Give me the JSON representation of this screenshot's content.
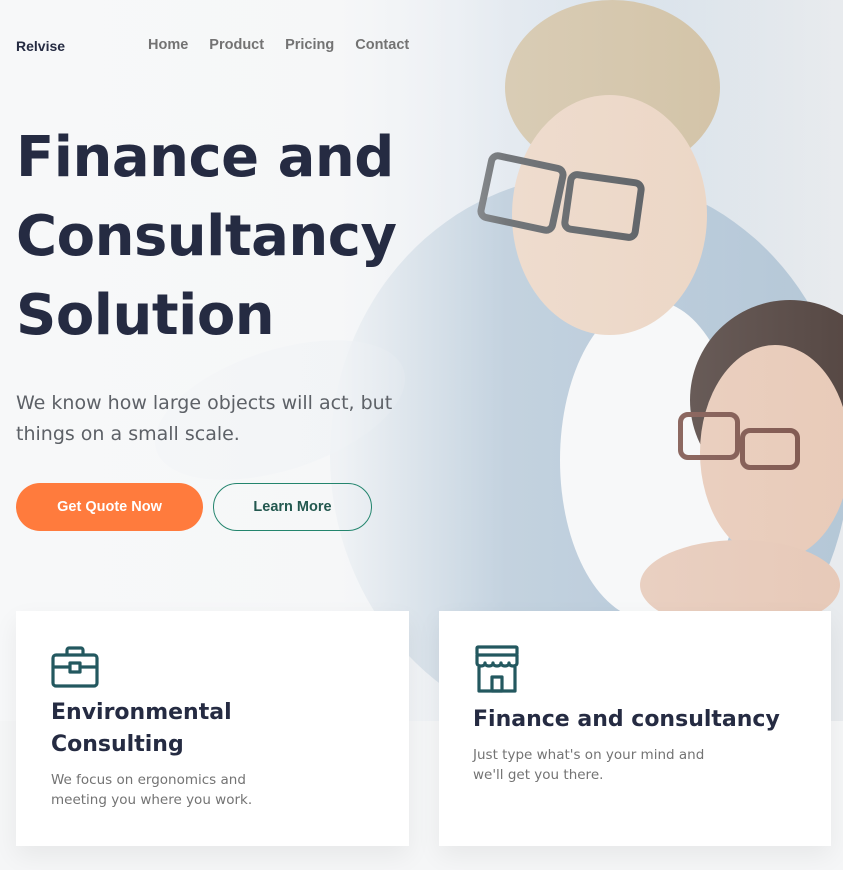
{
  "brand": {
    "name": "Relvise"
  },
  "nav": {
    "items": [
      {
        "label": "Home"
      },
      {
        "label": "Product"
      },
      {
        "label": "Pricing"
      },
      {
        "label": "Contact"
      }
    ]
  },
  "hero": {
    "title_lines": [
      "Finance and",
      "Consultancy",
      "Solution"
    ],
    "subtitle": "We know how large objects will act, but things on a small scale.",
    "primary_cta": "Get Quote Now",
    "secondary_cta": "Learn More",
    "image_icon": "people-photo"
  },
  "cards": [
    {
      "icon": "briefcase-icon",
      "title": "Environmental Consulting",
      "description": "We focus on ergonomics and meeting you where you work."
    },
    {
      "icon": "store-icon",
      "title": "Finance and consultancy",
      "description": "Just type what's on your mind and we'll get you there."
    }
  ],
  "colors": {
    "accent": "#ff7b3d",
    "primary_dark": "#252b42",
    "teal": "#23856d",
    "icon_teal": "#23585f",
    "muted_text": "#737373"
  }
}
